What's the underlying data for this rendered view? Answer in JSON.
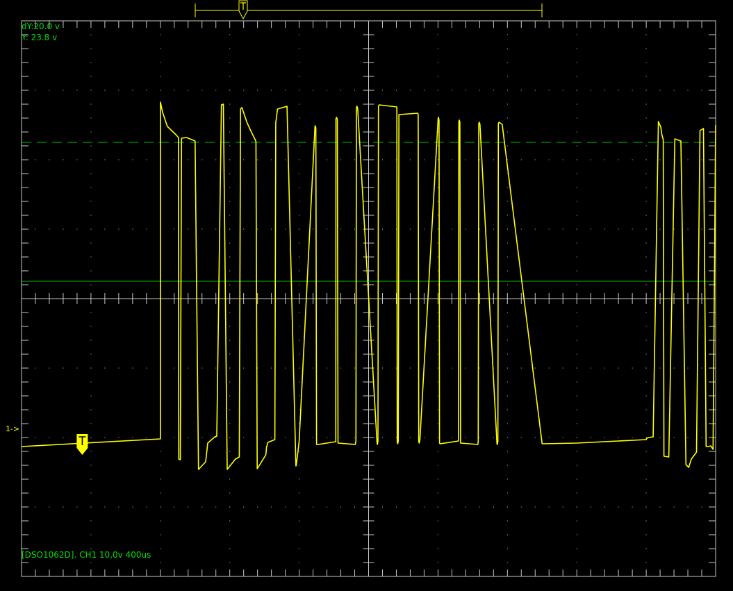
{
  "readouts": {
    "dy": "dY:20.0 v",
    "y": "Y:  23.8 v"
  },
  "status": "[DSO1062D]. CH1 10,0v 400us",
  "channel_marker": "1->",
  "colors": {
    "trace": "#ffff00",
    "cursor": "#00c000",
    "text_green": "#00e000",
    "grid": "#c8c8c8",
    "background": "#000000"
  },
  "icons": {
    "trigger_marker": "trigger-T-icon",
    "horizontal_position_marker": "position-T-icon"
  },
  "chart_data": {
    "type": "line",
    "title": "",
    "xlabel": "",
    "ylabel": "",
    "grid": true,
    "x_divisions": 10,
    "y_divisions": 8,
    "volts_per_div": 10,
    "time_per_div_us": 400,
    "xlim_us": [
      0,
      4000
    ],
    "ylim_v": [
      -18.7,
      61.3
    ],
    "cursors_v": [
      23.8,
      43.8
    ],
    "trigger_v": 0,
    "series": [
      {
        "values_note": "",
        "x_us": [
          0,
          800,
          800.5,
          812,
          840,
          890,
          904,
          906,
          915,
          922,
          950,
          981,
          1000,
          1020,
          1061,
          1073,
          1114,
          1125,
          1152,
          1163,
          1185,
          1233,
          1255,
          1262,
          1270,
          1300,
          1328,
          1348,
          1351,
          1358,
          1408,
          1412,
          1420,
          1460,
          1465,
          1475,
          1530,
          1581,
          1583,
          1594,
          1600,
          1691,
          1692,
          1696,
          1700,
          1709,
          1811,
          1812,
          1816,
          1820,
          1824,
          1923,
          1927,
          1930,
          1933,
          1937,
          2049,
          2051,
          2054,
          2057,
          2061,
          2163,
          2165,
          2168,
          2171,
          2175,
          2284,
          2286,
          2289,
          2292,
          2296,
          2401,
          2403,
          2406,
          2409,
          2413,
          2518,
          2520,
          2523,
          2526,
          2530,
          2630,
          2632,
          2635,
          2638,
          2642,
          2740,
          2742,
          2745,
          2748,
          2752,
          2770,
          3000,
          3200,
          3600,
          3603,
          3615,
          3640,
          3670,
          3684,
          3690,
          3698,
          3702,
          3730,
          3765,
          3800,
          3829,
          3845,
          3860,
          3890,
          3910,
          3930,
          3945,
          3960,
          3972,
          3985,
          4000
        ],
        "y_v": [
          0,
          1.1,
          49.6,
          48.2,
          46.1,
          44.9,
          44.5,
          -1.8,
          -1.9,
          44.4,
          44.5,
          44.2,
          44.0,
          -3.3,
          -2.2,
          0.5,
          1.4,
          1.5,
          49.2,
          49.3,
          -3.3,
          -1.8,
          -1.5,
          48.6,
          48.8,
          46.6,
          45.1,
          44.1,
          43.9,
          -3.2,
          -1.2,
          -0.1,
          0.6,
          1.0,
          46.6,
          48.6,
          49.0,
          -2.8,
          -2.7,
          -0.5,
          0.8,
          46.0,
          46.2,
          45.9,
          0.3,
          0.3,
          0.7,
          47.2,
          47.4,
          47.1,
          0.5,
          0.3,
          0.8,
          48.8,
          49.0,
          48.7,
          0.5,
          0.3,
          0.8,
          49.0,
          49.2,
          48.9,
          0.6,
          0.4,
          0.8,
          47.8,
          48.0,
          47.7,
          0.7,
          0.5,
          1.0,
          47.2,
          47.4,
          47.0,
          0.5,
          0.4,
          0.8,
          46.8,
          47.0,
          46.7,
          0.5,
          0.3,
          0.8,
          46.5,
          46.7,
          46.4,
          0.4,
          0.3,
          0.7,
          46.5,
          46.7,
          46.4,
          0.4,
          0.5,
          1.0,
          1.2,
          1.3,
          1.4,
          46.8,
          46.0,
          44.9,
          44.2,
          -1.4,
          -1.5,
          44.3,
          44.0,
          -2.6,
          -3.0,
          -1.8,
          -0.8,
          45.5,
          45.8,
          0.0,
          0.0,
          0.1,
          -0.4,
          46.3,
          46.4,
          -0.4,
          0.5,
          0.7
        ]
      }
    ]
  }
}
